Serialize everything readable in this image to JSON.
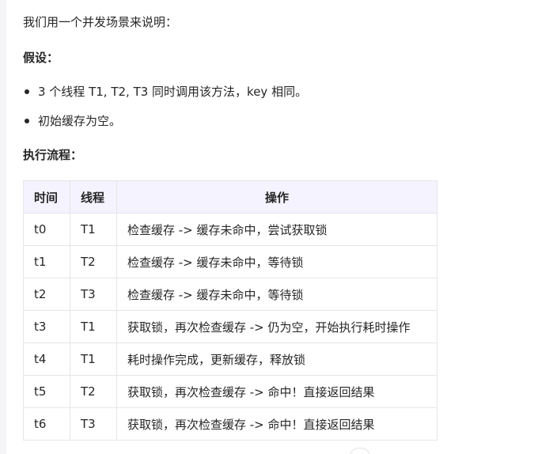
{
  "intro": "我们用一个并发场景来说明：",
  "assumptions": {
    "heading": "假设：",
    "items": [
      "3 个线程 T1, T2, T3 同时调用该方法，key 相同。",
      "初始缓存为空。"
    ]
  },
  "flow": {
    "heading": "执行流程：",
    "columns": [
      "时间",
      "线程",
      "操作"
    ],
    "rows": [
      [
        "t0",
        "T1",
        "检查缓存 -> 缓存未命中，尝试获取锁"
      ],
      [
        "t1",
        "T2",
        "检查缓存 -> 缓存未命中，等待锁"
      ],
      [
        "t2",
        "T3",
        "检查缓存 -> 缓存未命中，等待锁"
      ],
      [
        "t3",
        "T1",
        "获取锁，再次检查缓存 -> 仍为空，开始执行耗时操作"
      ],
      [
        "t4",
        "T1",
        "耗时操作完成，更新缓存，释放锁"
      ],
      [
        "t5",
        "T2",
        "获取锁，再次检查缓存 -> 命中！直接返回结果"
      ],
      [
        "t6",
        "T3",
        "获取锁，再次检查缓存 -> 命中！直接返回结果"
      ]
    ]
  }
}
